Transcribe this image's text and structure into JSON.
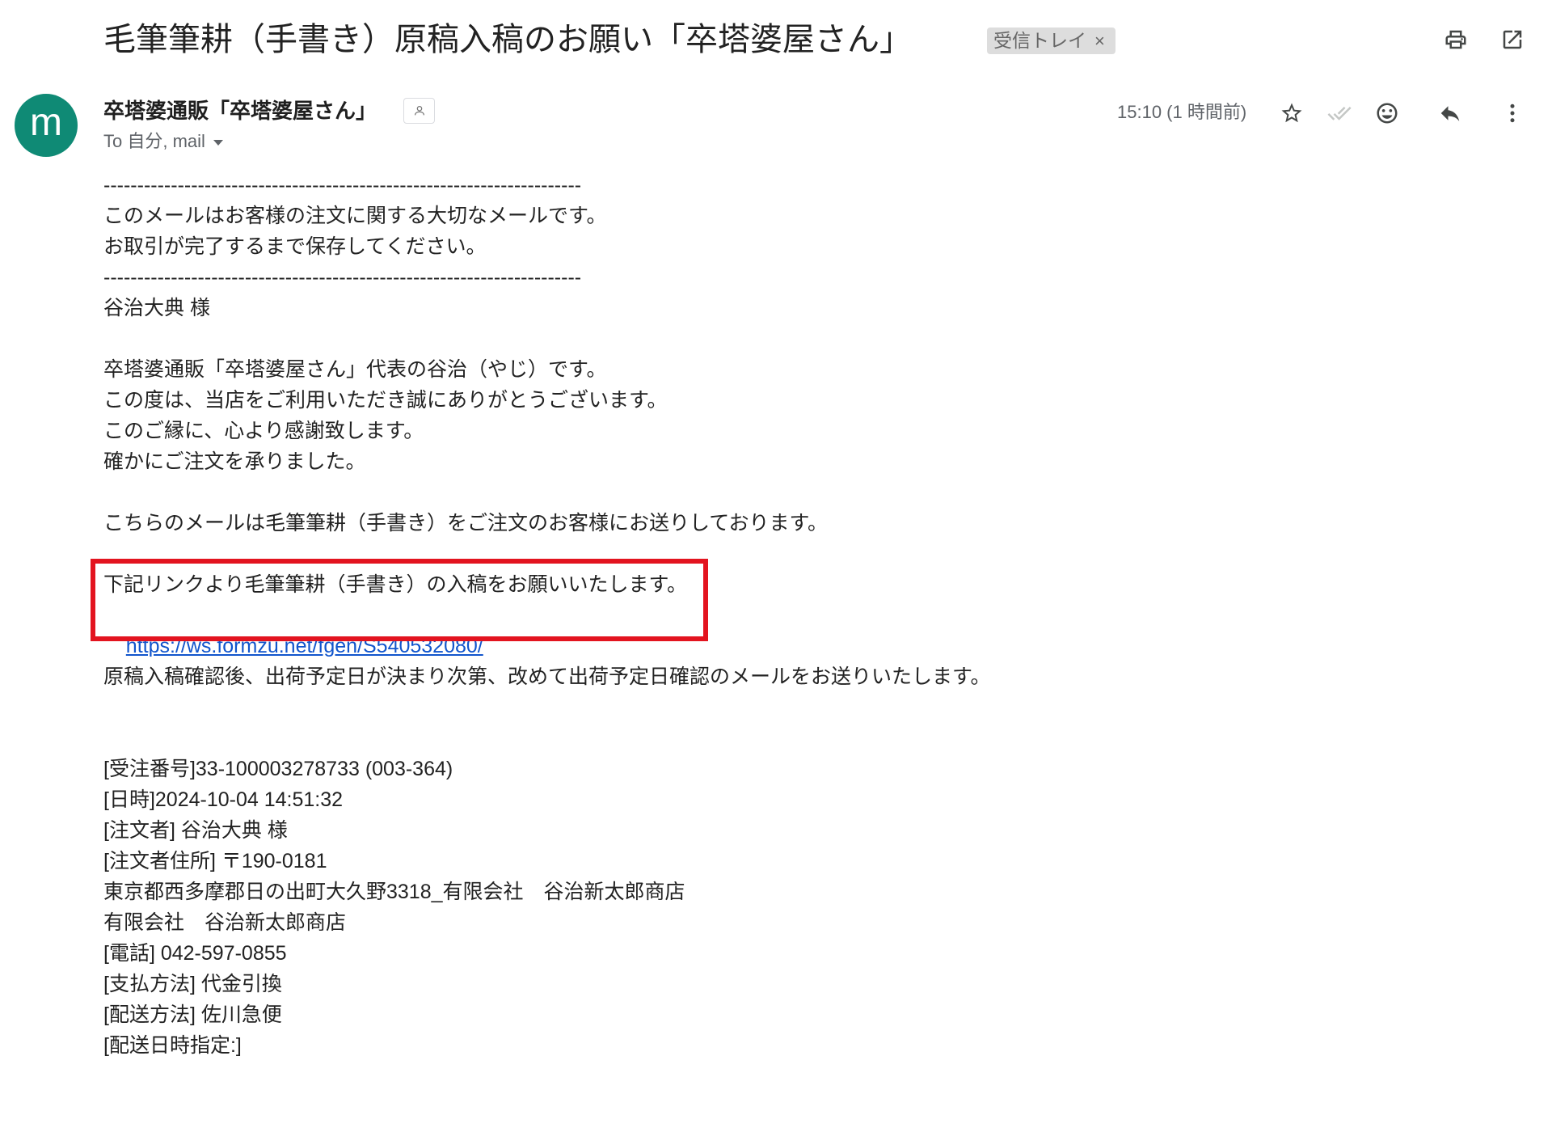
{
  "subject": {
    "title": "毛筆筆耕（手書き）原稿入稿のお願い「卒塔婆屋さん」",
    "label_chip": "受信トレイ",
    "chip_close": "×"
  },
  "header_actions": [
    "print-icon",
    "open-in-new-icon"
  ],
  "sender": {
    "avatar_letter": "m",
    "avatar_color": "#0f8a75",
    "name": "卒塔婆通販「卒塔婆屋さん」",
    "recipients": "To 自分, mail",
    "timestamp": "15:10 (1 時間前)"
  },
  "message_actions": [
    "star-icon",
    "double-check-icon",
    "emoji-icon",
    "reply-icon",
    "more-vertical-icon"
  ],
  "body": {
    "separator": "-----------------------------------------------------------------------",
    "notice_lines": [
      "このメールはお客様の注文に関する大切なメールです。",
      "お取引が完了するまで保存してください。"
    ],
    "greeting": "谷治大典 様",
    "intro_lines": [
      "卒塔婆通販「卒塔婆屋さん」代表の谷治（やじ）です。",
      "この度は、当店をご利用いただき誠にありがとうございます。",
      "このご縁に、心より感謝致します。",
      "確かにご注文を承りました。"
    ],
    "audience_line": "こちらのメールは毛筆筆耕（手書き）をご注文のお客様にお送りしております。",
    "request_line": "下記リンクより毛筆筆耕（手書き）の入稿をお願いいたします。",
    "form_link": "https://ws.formzu.net/fgen/S540532080/",
    "followup_line": "原稿入稿確認後、出荷予定日が決まり次第、改めて出荷予定日確認のメールをお送りいたします。",
    "order_details": [
      "[受注番号]33-100003278733 (003-364)",
      "[日時]2024-10-04 14:51:32",
      "[注文者] 谷治大典 様",
      "[注文者住所] 〒190-0181",
      "東京都西多摩郡日の出町大久野3318_有限会社　谷治新太郎商店",
      "有限会社　谷治新太郎商店",
      "[電話] 042-597-0855",
      "[支払方法] 代金引換",
      "[配送方法] 佐川急便",
      "[配送日時指定:]"
    ]
  },
  "colors": {
    "link": "#1155cc",
    "highlight": "#e3141f"
  }
}
